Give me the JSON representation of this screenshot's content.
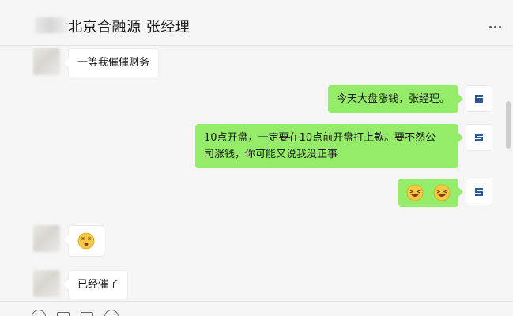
{
  "window": {
    "controls": [
      "pin-icon",
      "minimize-icon",
      "maximize-icon",
      "close-icon"
    ]
  },
  "header": {
    "title": "北京合融源 张经理"
  },
  "messages": [
    {
      "side": "left",
      "type": "text",
      "text": "一等我催催财务"
    },
    {
      "side": "right",
      "type": "text",
      "text": "今天大盘涨钱，张经理。"
    },
    {
      "side": "right",
      "type": "text",
      "line1": "10点开盘，一定要在10点前开盘打上款。要不然公",
      "line2": "司涨钱，你可能又说我没正事"
    },
    {
      "side": "right",
      "type": "emoji",
      "emojis": [
        "squint-laugh-emoji",
        "squint-laugh-emoji"
      ]
    },
    {
      "side": "left",
      "type": "emoji",
      "emojis": [
        "dizzy-face-emoji"
      ]
    },
    {
      "side": "left",
      "type": "text",
      "text": "已经催了"
    }
  ],
  "colors": {
    "self_bubble": "#95ec69",
    "other_bubble": "#ffffff",
    "background": "#f5f5f5"
  }
}
